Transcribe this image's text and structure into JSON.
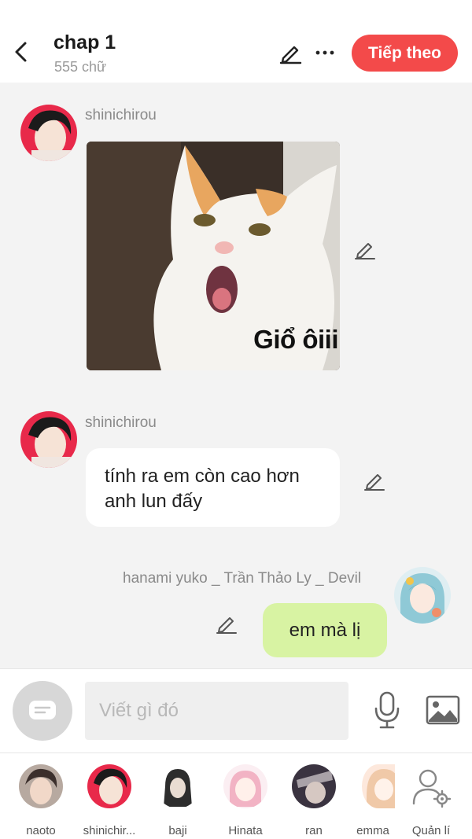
{
  "header": {
    "title": "chap 1",
    "subtitle": "555 chữ",
    "next_label": "Tiếp theo"
  },
  "messages": [
    {
      "sender": "shinichirou",
      "type": "image",
      "caption": "Giổ ôiii"
    },
    {
      "sender": "shinichirou",
      "type": "text",
      "line1": "tính ra em còn cao hơn",
      "line2": "anh lun đấy"
    },
    {
      "sender": "hanami yuko _ Trần Thảo Ly _ Devil",
      "type": "text",
      "text": "em mà lị"
    }
  ],
  "composer": {
    "placeholder": "Viết gì đó"
  },
  "roster": [
    {
      "name": "naoto",
      "color": "#4a4040"
    },
    {
      "name": "shinichir...",
      "color": "#e8294a"
    },
    {
      "name": "baji",
      "color": "#5a5a5a"
    },
    {
      "name": "Hinata",
      "color": "#f2b3c4"
    },
    {
      "name": "ran",
      "color": "#3a3340"
    },
    {
      "name": "emma",
      "color": "#f0c9a8"
    },
    {
      "name": "Quản lí",
      "color": "#888888"
    }
  ],
  "colors": {
    "accent": "#f34a4a",
    "outgoing_bubble": "#d8f3a3",
    "incoming_bubble": "#ffffff",
    "background": "#f3f3f3"
  }
}
